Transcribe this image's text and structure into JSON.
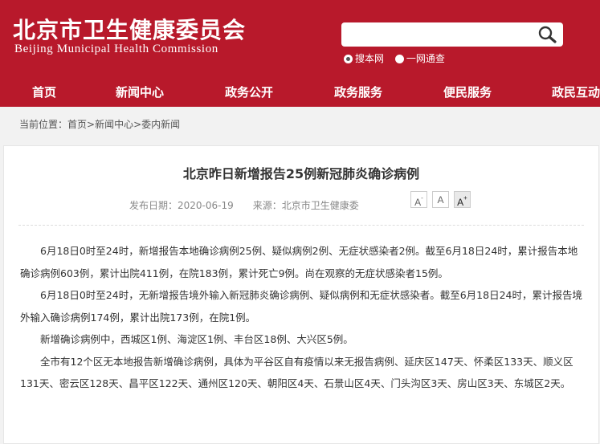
{
  "header": {
    "logo_cn": "北京市卫生健康委员会",
    "logo_en": "Beijing Municipal Health Commission",
    "search_placeholder": "",
    "radio_options": [
      "搜本网",
      "一网通查"
    ],
    "nav": [
      "首页",
      "新闻中心",
      "政务公开",
      "政务服务",
      "便民服务",
      "政民互动"
    ]
  },
  "breadcrumb": {
    "prefix": "当前位置：",
    "items": [
      "首页",
      "新闻中心",
      "委内新闻"
    ],
    "separator": ">"
  },
  "article": {
    "title": "北京昨日新增报告25例新冠肺炎确诊病例",
    "date_label": "发布日期：2020-06-19",
    "source_label": "来源：北京市卫生健康委",
    "font_buttons": [
      "A-",
      "A",
      "A+"
    ],
    "paragraphs": [
      "6月18日0时至24时，新增报告本地确诊病例25例、疑似病例2例、无症状感染者2例。截至6月18日24时，累计报告本地确诊病例603例，累计出院411例，在院183例，累计死亡9例。尚在观察的无症状感染者15例。",
      "6月18日0时至24时，无新增报告境外输入新冠肺炎确诊病例、疑似病例和无症状感染者。截至6月18日24时，累计报告境外输入确诊病例174例，累计出院173例，在院1例。",
      "新增确诊病例中，西城区1例、海淀区1例、丰台区18例、大兴区5例。",
      "全市有12个区无本地报告新增确诊病例，具体为平谷区自有疫情以来无报告病例、延庆区147天、怀柔区133天、顺义区131天、密云区128天、昌平区122天、通州区120天、朝阳区4天、石景山区4天、门头沟区3天、房山区3天、东城区2天。"
    ]
  },
  "colors": {
    "brand_red": "#b8192b"
  },
  "icons": {
    "search": "search-icon"
  }
}
